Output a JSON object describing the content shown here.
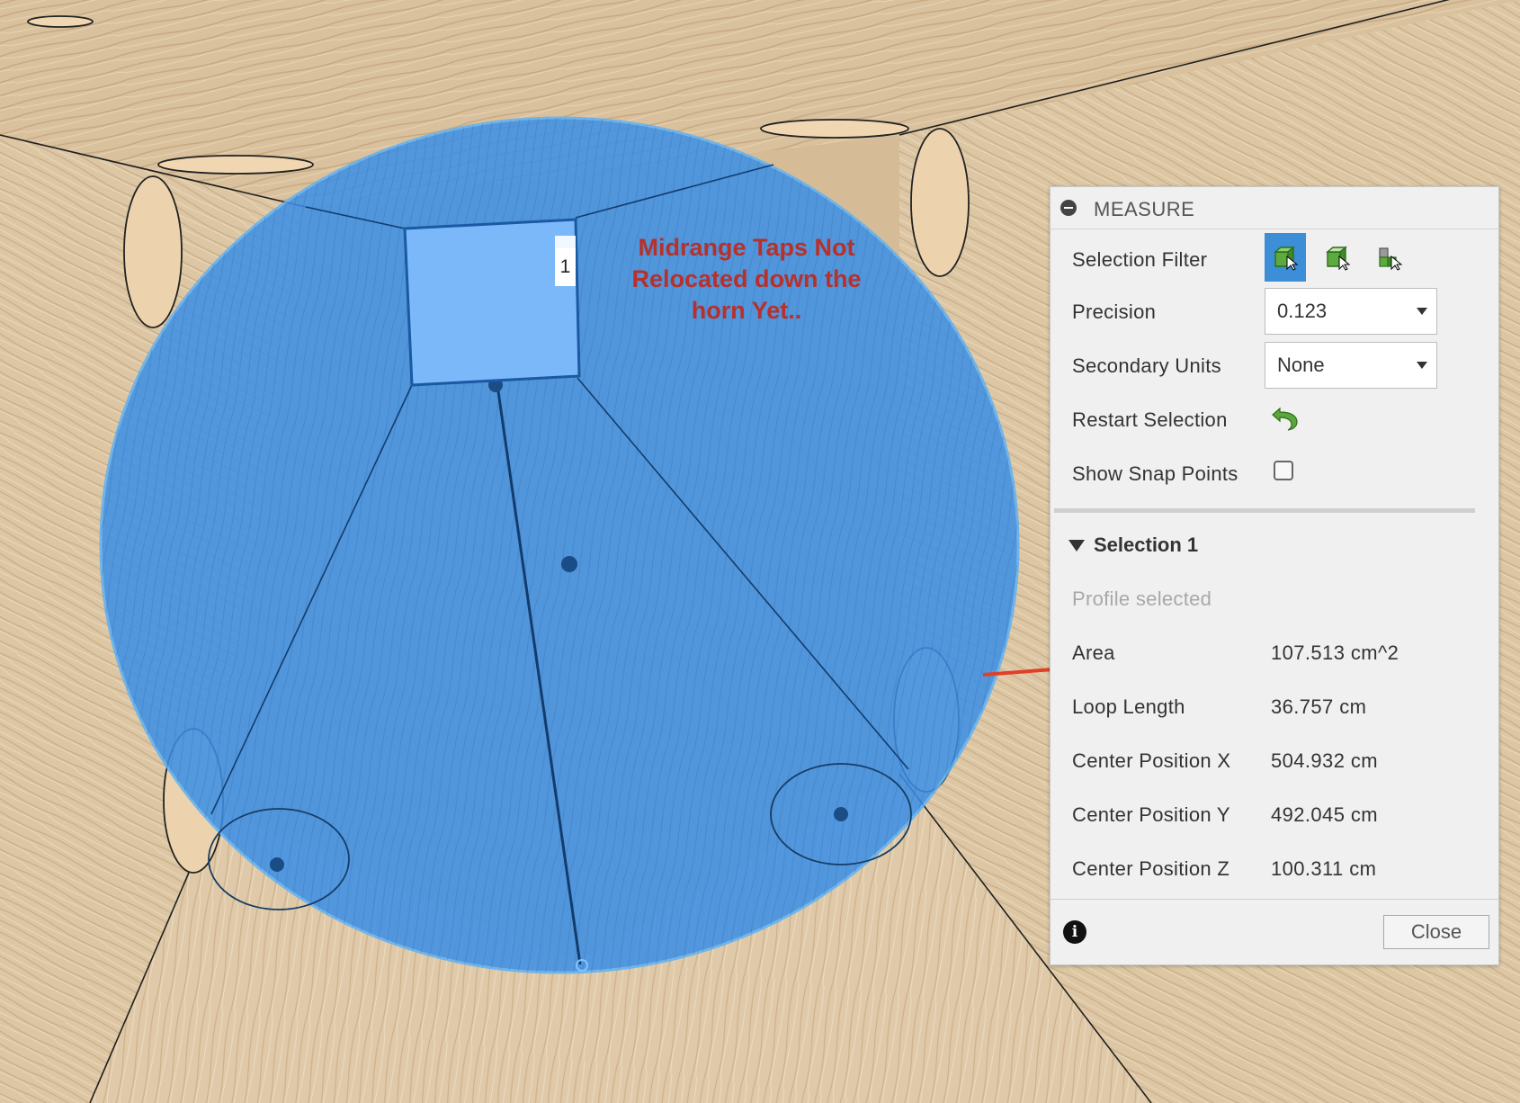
{
  "annotation": {
    "text": "Midrange Taps Not Relocated down the horn Yet.."
  },
  "selection_marker": {
    "label": "1"
  },
  "panel": {
    "title": "MEASURE",
    "selection_filter": {
      "label": "Selection Filter",
      "options": [
        "body-filter-icon",
        "face-filter-icon",
        "edge-filter-icon"
      ],
      "active": "body-filter-icon"
    },
    "precision": {
      "label": "Precision",
      "value": "0.123"
    },
    "secondary_units": {
      "label": "Secondary Units",
      "value": "None"
    },
    "restart_selection": {
      "label": "Restart Selection",
      "icon": "undo-arrow-icon"
    },
    "show_snap_points": {
      "label": "Show Snap Points",
      "checked": false
    },
    "selection": {
      "title": "Selection 1",
      "status": "Profile selected",
      "rows": [
        {
          "label": "Area",
          "value": "107.513 cm^2"
        },
        {
          "label": "Loop Length",
          "value": "36.757 cm"
        },
        {
          "label": "Center Position X",
          "value": "504.932 cm"
        },
        {
          "label": "Center Position Y",
          "value": "492.045 cm"
        },
        {
          "label": "Center Position Z",
          "value": "100.311 cm"
        }
      ]
    },
    "close_label": "Close"
  },
  "colors": {
    "highlight": "#3c8fe6",
    "selected_face": "#7ab8f9",
    "annotation_text": "#b8302a",
    "arrow": "#e0402a",
    "wood": "#d6bc96",
    "filter_active": "#3c8fd6"
  }
}
